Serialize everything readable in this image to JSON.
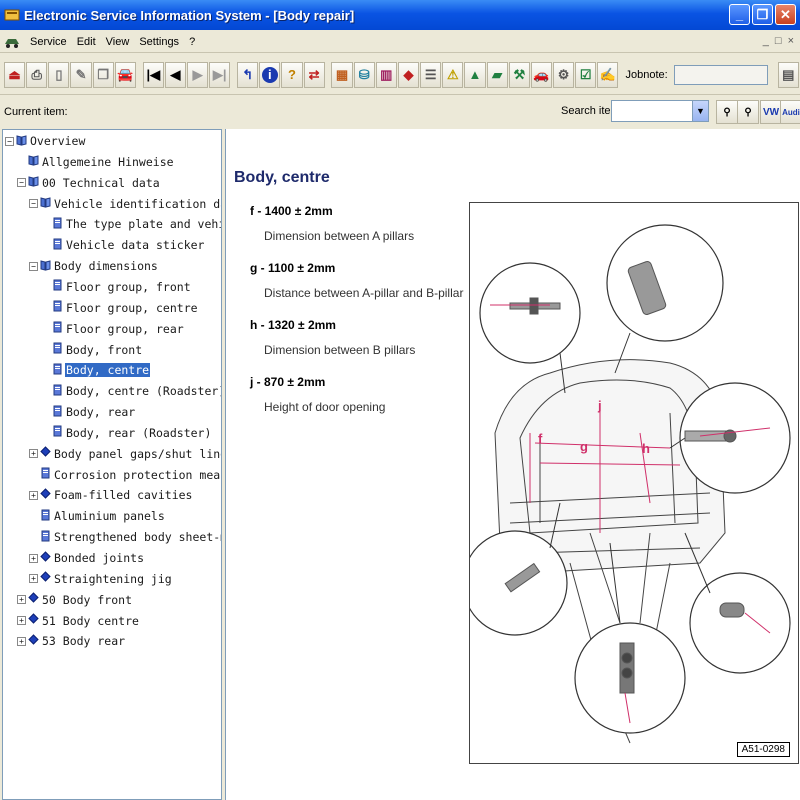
{
  "window": {
    "title": "Electronic Service Information System - [Body repair]"
  },
  "menu": {
    "items": [
      "Service",
      "Edit",
      "View",
      "Settings",
      "?"
    ]
  },
  "toolbar": {
    "buttons": [
      "exit-icon",
      "print-icon",
      "new-document-icon",
      "edit-document-icon",
      "copy-document-icon",
      "vehicle-icon",
      "first-icon",
      "previous-icon",
      "next-icon",
      "last-icon",
      "back-arrow-icon",
      "info-icon",
      "help-icon",
      "sync-icon",
      "grid-icon",
      "database-icon",
      "book-icon",
      "eraser-icon",
      "list-icon",
      "warning-icon",
      "ruler-icon",
      "tool-icon",
      "wrench-icon",
      "car-icon",
      "clipboard-icon",
      "checklist-icon",
      "key-icon"
    ],
    "jobnote_label": "Jobnote:",
    "jobnote_value": ""
  },
  "currentbar": {
    "current_label": "Current item:",
    "search_label": "Search item:",
    "search_value": "",
    "mdi_buttons": [
      "_",
      "□",
      "×"
    ],
    "vw_audi_buttons": [
      "VW",
      "Audi"
    ]
  },
  "tree": [
    {
      "label": "Overview",
      "depth": 0,
      "expander": "−",
      "icon": "book-open-icon"
    },
    {
      "label": "Allgemeine Hinweise",
      "depth": 1,
      "expander": "",
      "icon": "book-open-icon"
    },
    {
      "label": "00 Technical data",
      "depth": 1,
      "expander": "−",
      "icon": "book-open-icon"
    },
    {
      "label": "Vehicle identification data",
      "depth": 2,
      "expander": "−",
      "icon": "book-open-icon"
    },
    {
      "label": "The type plate and vehicle",
      "depth": 3,
      "expander": "",
      "icon": "page-icon"
    },
    {
      "label": "Vehicle data sticker",
      "depth": 3,
      "expander": "",
      "icon": "page-icon"
    },
    {
      "label": "Body dimensions",
      "depth": 2,
      "expander": "−",
      "icon": "book-open-icon"
    },
    {
      "label": "Floor group, front",
      "depth": 3,
      "expander": "",
      "icon": "page-icon"
    },
    {
      "label": "Floor group, centre",
      "depth": 3,
      "expander": "",
      "icon": "page-icon"
    },
    {
      "label": "Floor group, rear",
      "depth": 3,
      "expander": "",
      "icon": "page-icon"
    },
    {
      "label": "Body, front",
      "depth": 3,
      "expander": "",
      "icon": "page-icon"
    },
    {
      "label": "Body, centre",
      "depth": 3,
      "expander": "",
      "icon": "page-icon",
      "selected": true
    },
    {
      "label": "Body, centre (Roadster)",
      "depth": 3,
      "expander": "",
      "icon": "page-icon"
    },
    {
      "label": "Body, rear",
      "depth": 3,
      "expander": "",
      "icon": "page-icon"
    },
    {
      "label": "Body, rear (Roadster)",
      "depth": 3,
      "expander": "",
      "icon": "page-icon"
    },
    {
      "label": "Body panel gaps/shut lines",
      "depth": 2,
      "expander": "+",
      "icon": "book-closed-icon"
    },
    {
      "label": "Corrosion protection measures",
      "depth": 2,
      "expander": "",
      "icon": "page-icon"
    },
    {
      "label": "Foam-filled cavities",
      "depth": 2,
      "expander": "+",
      "icon": "book-closed-icon"
    },
    {
      "label": "Aluminium panels",
      "depth": 2,
      "expander": "",
      "icon": "page-icon"
    },
    {
      "label": "Strengthened body sheet-metal",
      "depth": 2,
      "expander": "",
      "icon": "page-icon"
    },
    {
      "label": "Bonded joints",
      "depth": 2,
      "expander": "+",
      "icon": "book-closed-icon"
    },
    {
      "label": "Straightening jig",
      "depth": 2,
      "expander": "+",
      "icon": "book-closed-icon"
    },
    {
      "label": "50 Body front",
      "depth": 1,
      "expander": "+",
      "icon": "book-closed-icon"
    },
    {
      "label": "51 Body centre",
      "depth": 1,
      "expander": "+",
      "icon": "book-closed-icon"
    },
    {
      "label": "53 Body rear",
      "depth": 1,
      "expander": "+",
      "icon": "book-closed-icon"
    }
  ],
  "content": {
    "heading": "Body, centre",
    "specs": [
      {
        "title": "f - 1400 ± 2mm",
        "desc": "Dimension between A pillars"
      },
      {
        "title": "g - 1100 ± 2mm",
        "desc": "Distance between A-pillar and B-pillar"
      },
      {
        "title": "h - 1320 ± 2mm",
        "desc": "Dimension between B pillars"
      },
      {
        "title": "j - 870 ± 2mm",
        "desc": "Height of door opening"
      }
    ],
    "figure_label": "A51-0298",
    "figure_letters": [
      "f",
      "g",
      "h",
      "j"
    ]
  },
  "colors": {
    "title_blue": "#0a54e3",
    "selection": "#316ac5",
    "heading": "#1e2a6b",
    "dimension_line": "#d0306a"
  }
}
